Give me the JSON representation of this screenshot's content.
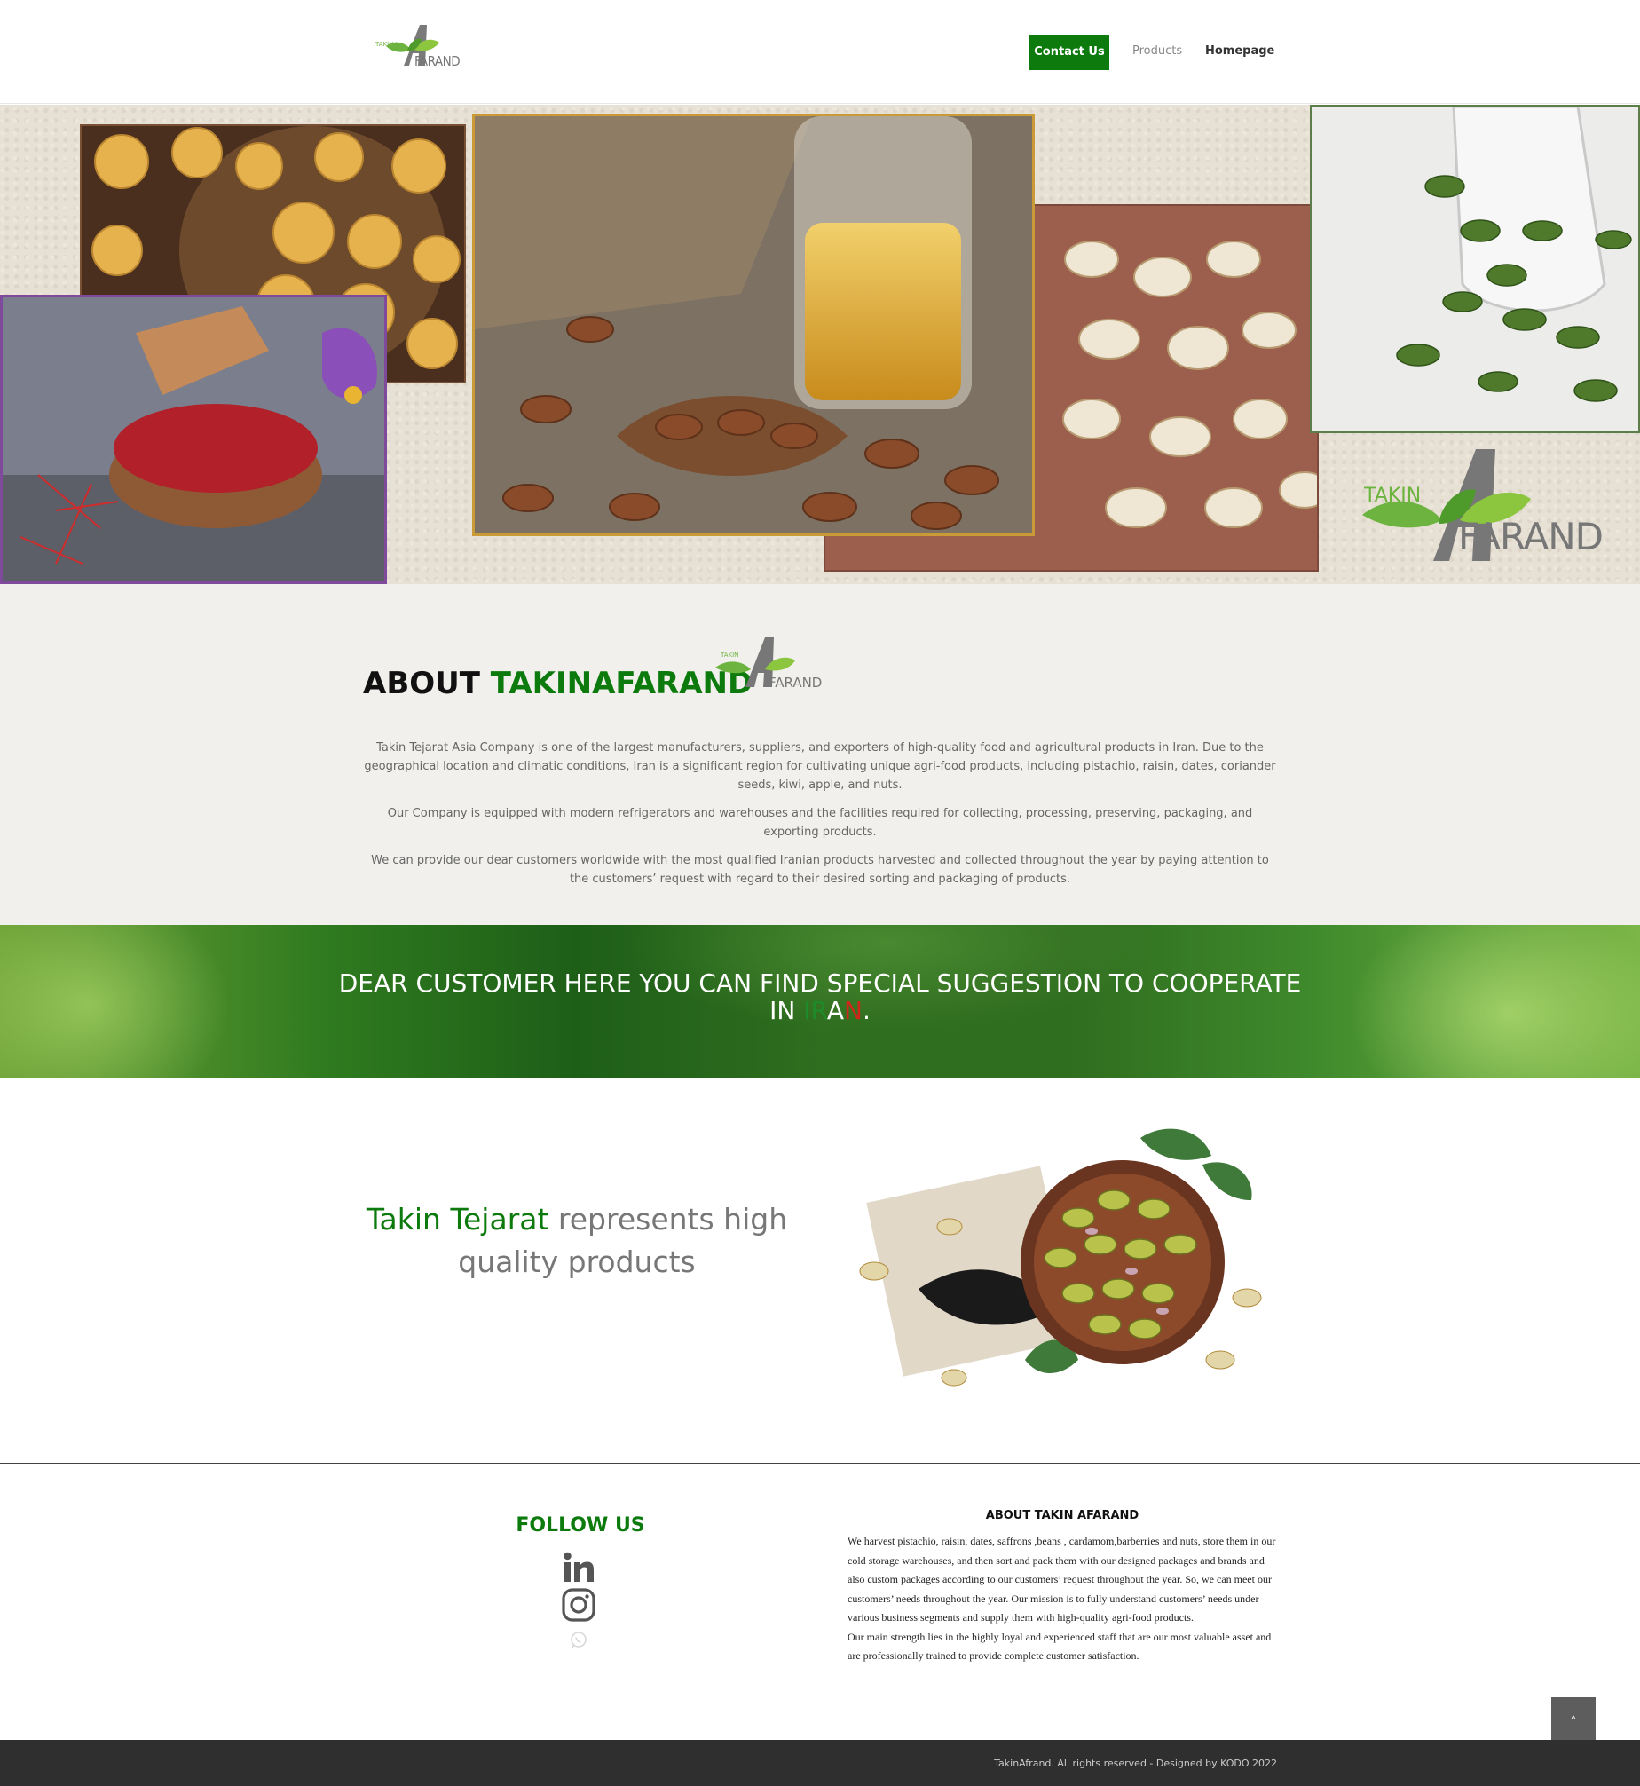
{
  "header": {
    "logo": {
      "small_text": "TAKIN",
      "large_text": "FARAND"
    },
    "nav": {
      "contact": "Contact Us",
      "products": "Products",
      "homepage": "Homepage"
    }
  },
  "hero": {
    "logo_takin": "TAKIN",
    "logo_farand": "FARAND"
  },
  "about": {
    "title_prefix": "ABOUT",
    "title_brand": "TAKINAFARAND",
    "logo_small": "TAKIN",
    "logo_large": "FARAND",
    "paragraphs": [
      "Takin Tejarat Asia Company is one of the largest manufacturers, suppliers, and exporters of high-quality food and agricultural products in Iran. Due to the geographical location and climatic conditions, Iran is a significant region for cultivating unique agri-food products, including pistachio, raisin, dates, coriander seeds, kiwi, apple, and nuts.",
      "Our Company is equipped with modern refrigerators and warehouses and the facilities required for collecting, processing, preserving, packaging, and exporting products.",
      "We can provide our dear customers worldwide with the most qualified Iranian products harvested and collected throughout the year by paying attention to the customers’ request with regard to their desired sorting and packaging of products."
    ]
  },
  "banner": {
    "line1": "DEAR CUSTOMER HERE YOU CAN FIND SPECIAL SUGGESTION TO COOPERATE",
    "line2_prefix": "IN ",
    "iran_1": "IR",
    "iran_2": "A",
    "iran_3": "N",
    "line2_suffix": "."
  },
  "quality": {
    "brand": "Takin Tejarat",
    "rest": " represents high quality products"
  },
  "footer": {
    "follow_title": "FOLLOW US",
    "social_icons": [
      "linkedin-icon",
      "instagram-icon",
      "whatsapp-icon"
    ],
    "about_title": "ABOUT TAKIN AFARAND",
    "about_p1": "We harvest pistachio, raisin, dates, saffrons ,beans , cardamom,barberries and nuts, store them in our cold storage warehouses, and then sort and pack them with our designed packages and brands and also custom packages according to our customers’ request throughout the year. So, we can meet our customers’ needs throughout the year. Our mission is to fully understand customers’ needs under various business segments and supply them with high-quality agri-food products.",
    "about_p2": "Our main strength lies in the highly loyal and experienced staff that are our most valuable asset and are professionally trained to provide complete customer satisfaction.",
    "scroll_top": "^",
    "copyright": "TakinAfrand. All rights reserved - Designed by KODO 2022"
  },
  "colors": {
    "brand_green": "#0c7a0c",
    "leaf_green": "#6cb33f",
    "footer_bg": "#2f2f2f"
  }
}
